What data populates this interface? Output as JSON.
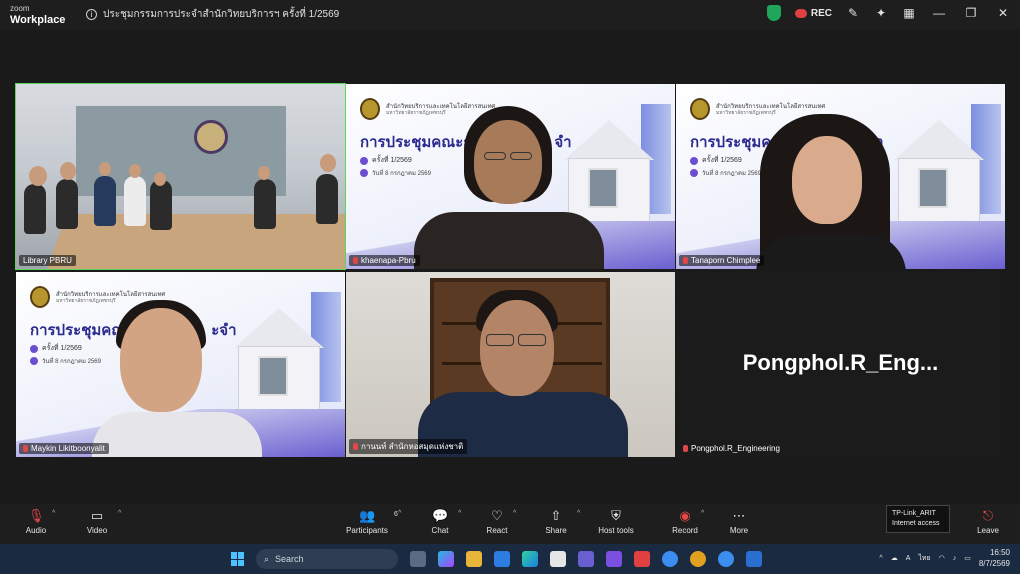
{
  "app": {
    "brand_line1": "zoom",
    "brand_line2": "Workplace",
    "meeting_title": "ประชุมกรรมการประจำสำนักวิทยบริการฯ ครั้งที่ 1/2569",
    "rec_label": "REC",
    "accent_color": "#5bd65b"
  },
  "tiles": [
    {
      "name": "Library PBRU",
      "type": "room"
    },
    {
      "name": "khaenapa-Pbru",
      "type": "slide"
    },
    {
      "name": "Tanaporn Chimplee",
      "type": "slide"
    },
    {
      "name": "Maykin Likitboonyalit",
      "type": "slide"
    },
    {
      "name": "กานนท์ สำนักหอสมุดแห่งชาติ",
      "type": "office"
    },
    {
      "name": "Pongphol.R_Engineering",
      "type": "name",
      "big_name": "Pongphol.R_Eng..."
    }
  ],
  "slide": {
    "org": "สำนักวิทยบริการและเทคโนโลยีสารสนเทศ",
    "org_sub": "มหาวิทยาลัยราชภัฏเพชรบุรี",
    "title_a": "การประชุมคณะก",
    "title_b": "การประชุมคณะก",
    "title_c": "การประชุมคณ",
    "suffix_a": "จำ",
    "suffix_c": "ะจำ",
    "meeting_no": "ครั้งที่ 1/2569",
    "date": "วันที่ 8 กรกฎาคม 2569"
  },
  "toolbar": {
    "audio": "Audio",
    "video": "Video",
    "participants": "Participants",
    "participants_count": "6",
    "chat": "Chat",
    "react": "React",
    "share": "Share",
    "host_tools": "Host tools",
    "record": "Record",
    "more": "More",
    "leave": "Leave"
  },
  "tooltip": {
    "line1": "TP-Link_ARIT",
    "line2": "Internet access"
  },
  "taskbar": {
    "search": "Search",
    "lang": "ไทย",
    "time": "16:50",
    "date": "8/7/2569"
  }
}
